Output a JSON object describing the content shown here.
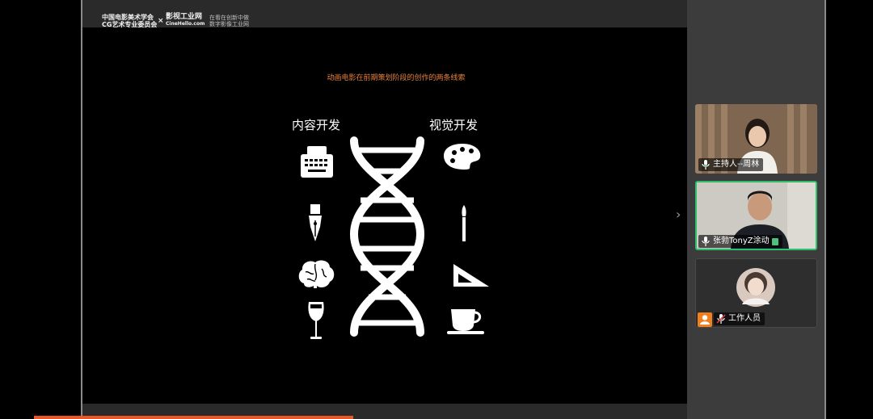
{
  "header": {
    "logo_line1": "中国电影美术学会",
    "logo_line2": "CG艺术专业委员会",
    "logo_x": "×",
    "brand": "影视工业网",
    "brand_url": "CineHello.com",
    "tagline_line1": "在看在创新中做",
    "tagline_line2": "数字影像工业网"
  },
  "slide": {
    "title": "动画电影在前期策划阶段的创作的两条线索",
    "left_heading": "内容开发",
    "right_heading": "视觉开发"
  },
  "participants": [
    {
      "name": "主持人--周林",
      "state": "mic-on"
    },
    {
      "name": "张勃TonyZ涂动",
      "state": "mic-on",
      "active": true
    },
    {
      "name": "工作人员",
      "state": "mic-muted"
    }
  ],
  "colors": {
    "accent": "#e8813a",
    "progress": "#e8572a",
    "active_border": "#2fbf6a"
  }
}
